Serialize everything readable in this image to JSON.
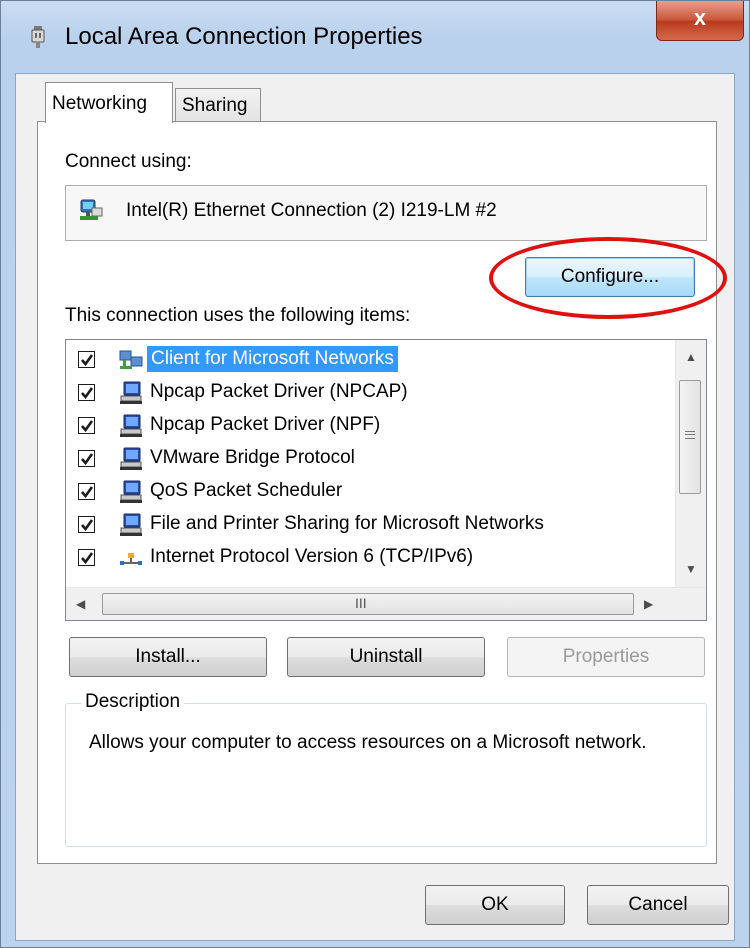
{
  "window": {
    "title": "Local Area Connection Properties",
    "close_glyph": "x"
  },
  "tabs": [
    {
      "label": "Networking"
    },
    {
      "label": "Sharing"
    }
  ],
  "connect_using": {
    "label": "Connect using:",
    "adapter": "Intel(R) Ethernet Connection (2) I219-LM #2",
    "configure_label": "Configure..."
  },
  "items": {
    "label": "This connection uses the following items:",
    "list": [
      {
        "label": "Client for Microsoft Networks",
        "checked": true,
        "selected": true,
        "icon": "network-client-icon"
      },
      {
        "label": "Npcap Packet Driver (NPCAP)",
        "checked": true,
        "icon": "network-service-icon"
      },
      {
        "label": "Npcap Packet Driver (NPF)",
        "checked": true,
        "icon": "network-service-icon"
      },
      {
        "label": "VMware Bridge Protocol",
        "checked": true,
        "icon": "network-service-icon"
      },
      {
        "label": "QoS Packet Scheduler",
        "checked": true,
        "icon": "network-service-icon"
      },
      {
        "label": "File and Printer Sharing for Microsoft Networks",
        "checked": true,
        "icon": "network-service-icon"
      },
      {
        "label": "Internet Protocol Version 6 (TCP/IPv6)",
        "checked": true,
        "icon": "protocol-icon"
      }
    ],
    "hscroll_grip": "III"
  },
  "buttons": {
    "install": "Install...",
    "uninstall": "Uninstall",
    "properties": "Properties",
    "ok": "OK",
    "cancel": "Cancel"
  },
  "description": {
    "legend": "Description",
    "text": "Allows your computer to access resources on a Microsoft network."
  },
  "colors": {
    "selection": "#3399ff",
    "annotation": "#e01010"
  }
}
